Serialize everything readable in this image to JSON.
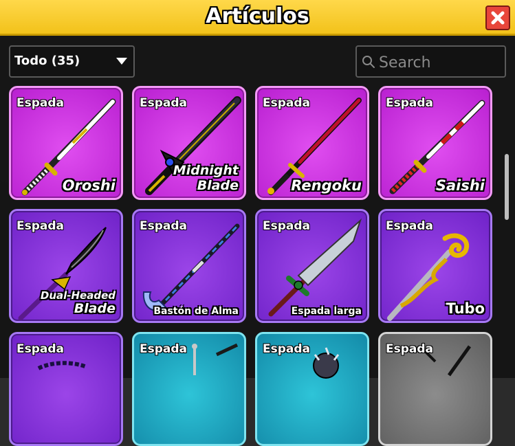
{
  "header": {
    "title": "Artículos"
  },
  "filter": {
    "selected": "Todo (35)"
  },
  "search": {
    "placeholder": "Search"
  },
  "colors": {
    "mythic": "#d93ee8",
    "legendary": "#8a3ae0",
    "rare": "#1fa9c4",
    "common": "#7a7a7a",
    "header": "#f5c62a",
    "close": "#e8463b"
  },
  "items": [
    {
      "type": "Espada",
      "name": "Oroshi",
      "rarity": "mythic"
    },
    {
      "type": "Espada",
      "name_line1": "Midnight",
      "name_line2": "Blade",
      "rarity": "mythic"
    },
    {
      "type": "Espada",
      "name": "Rengoku",
      "rarity": "mythic"
    },
    {
      "type": "Espada",
      "name": "Saishi",
      "rarity": "mythic"
    },
    {
      "type": "Espada",
      "name_line1": "Dual-Headed",
      "name_line2": "Blade",
      "rarity": "legendary"
    },
    {
      "type": "Espada",
      "name": "Bastón de Alma",
      "rarity": "legendary"
    },
    {
      "type": "Espada",
      "name": "Espada larga",
      "rarity": "legendary"
    },
    {
      "type": "Espada",
      "name": "Tubo",
      "rarity": "legendary"
    },
    {
      "type": "Espada",
      "name": "",
      "rarity": "legendary"
    },
    {
      "type": "Espada",
      "name": "",
      "rarity": "rare"
    },
    {
      "type": "Espada",
      "name": "",
      "rarity": "rare"
    },
    {
      "type": "Espada",
      "name": "",
      "rarity": "common"
    }
  ]
}
